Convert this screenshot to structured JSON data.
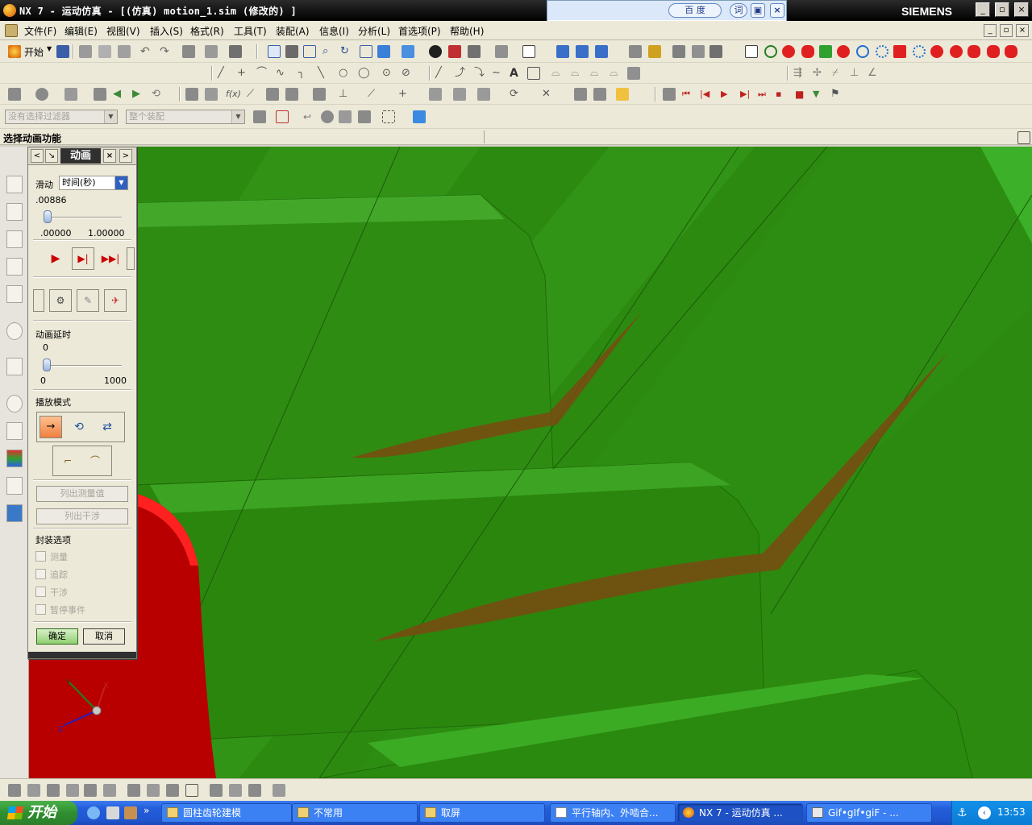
{
  "window": {
    "title": "NX 7 - 运动仿真 - [(仿真) motion_1.sim (修改的) ]",
    "brand": "SIEMENS",
    "buttons": {
      "minimize": "_",
      "maximize": "▫",
      "close": "×"
    }
  },
  "baidu_toolbar": {
    "search_label": "百 度",
    "dict_label": "词",
    "close": "×"
  },
  "menu": {
    "items": [
      "文件(F)",
      "编辑(E)",
      "视图(V)",
      "插入(S)",
      "格式(R)",
      "工具(T)",
      "装配(A)",
      "信息(I)",
      "分析(L)",
      "首选项(P)",
      "帮助(H)"
    ]
  },
  "toolbar": {
    "start_label": "开始"
  },
  "filters": {
    "selection_filter": "没有选择过滤器",
    "scope": "整个装配"
  },
  "status": {
    "prompt": "选择动画功能"
  },
  "dialog": {
    "title": "动画",
    "scrub_label": "滑动",
    "scrub_mode": "时间(秒)",
    "time_value": ".00886",
    "time_min": ".00000",
    "time_max": "1.00000",
    "time_fraction": 0.00886,
    "delay_label": "动画延时",
    "delay_value": "0",
    "delay_min": "0",
    "delay_max": "1000",
    "playback_label": "播放模式",
    "list_measurements": "列出测量值",
    "list_interference": "列出干涉",
    "envelope_label": "封装选项",
    "options": [
      "测量",
      "追踪",
      "干涉",
      "暂停事件"
    ],
    "ok": "确定",
    "cancel": "取消"
  },
  "triad": {
    "x": "X",
    "y": "Y",
    "z": "Z"
  },
  "taskbar": {
    "start": "开始",
    "tasks": [
      "圆柱齿轮建模",
      "不常用",
      "取屏",
      "平行轴内、外啮合...",
      "NX 7 - 运动仿真 ...",
      "Gif•gIf•giF - ..."
    ],
    "clock": "13:53"
  },
  "colors": {
    "gear_green": "#2a8a0f",
    "part_red": "#c40000",
    "accent_orange": "#7a4a10"
  }
}
